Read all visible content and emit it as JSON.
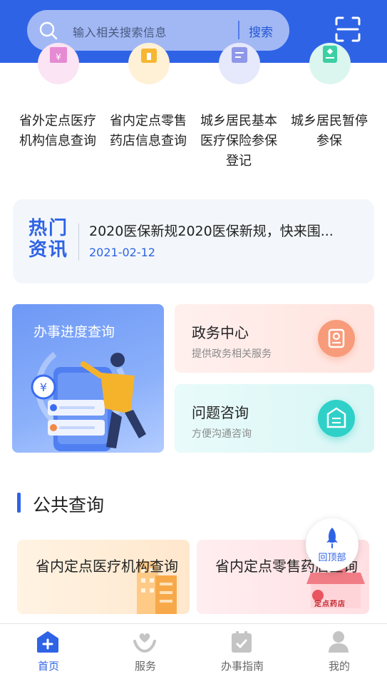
{
  "colors": {
    "primary": "#2f63e6",
    "accent_orange": "#f29a2e",
    "nav_inactive": "#b8b8b8"
  },
  "search": {
    "placeholder": "输入相关搜索信息",
    "button": "搜索"
  },
  "services": [
    {
      "icon": "hospital-icon",
      "label_line1": "省外定点医疗",
      "label_line2": "机构信息查询",
      "label_line3": ""
    },
    {
      "icon": "pharmacy-icon",
      "label_line1": "省内定点零售",
      "label_line2": "药店信息查询",
      "label_line3": ""
    },
    {
      "icon": "insurance-register-icon",
      "label_line1": "城乡居民基本",
      "label_line2": "医疗保险参保",
      "label_line3": "登记"
    },
    {
      "icon": "suspend-insurance-icon",
      "label_line1": "城乡居民暂停",
      "label_line2": "参保",
      "label_line3": ""
    }
  ],
  "news": {
    "badge_line1": "热门",
    "badge_line2": "资讯",
    "title": "2020医保新规2020医保新规，快来围...",
    "date": "2021-02-12"
  },
  "cards": {
    "progress": {
      "title": "办事进度查询"
    },
    "gov": {
      "title": "政务中心",
      "subtitle": "提供政务相关服务"
    },
    "faq": {
      "title": "问题咨询",
      "subtitle": "方便沟通咨询"
    }
  },
  "public": {
    "section_title": "公共查询",
    "items": [
      {
        "title": "省内定点医疗机构查询"
      },
      {
        "title": "省内定点零售药店查询",
        "sign": "定点药店"
      }
    ]
  },
  "back_to_top": "回顶部",
  "nav": [
    {
      "label": "首页",
      "icon": "home-icon",
      "active": true
    },
    {
      "label": "服务",
      "icon": "service-icon",
      "active": false
    },
    {
      "label": "办事指南",
      "icon": "guide-icon",
      "active": false
    },
    {
      "label": "我的",
      "icon": "user-icon",
      "active": false
    }
  ]
}
